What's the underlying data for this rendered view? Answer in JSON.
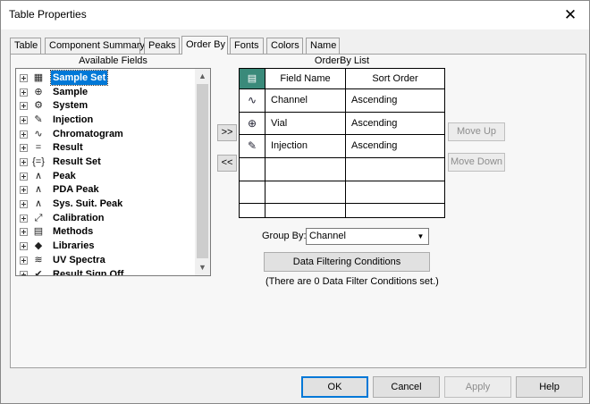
{
  "window": {
    "title": "Table Properties",
    "close_glyph": "✕"
  },
  "tabs": [
    {
      "label": "Table"
    },
    {
      "label": "Component Summary"
    },
    {
      "label": "Peaks"
    },
    {
      "label": "Order By",
      "active": true
    },
    {
      "label": "Fonts"
    },
    {
      "label": "Colors"
    },
    {
      "label": "Name"
    }
  ],
  "available_fields": {
    "label": "Available Fields",
    "items": [
      {
        "label": "Sample Set",
        "icon": "sample-set-icon",
        "glyph": "▦",
        "selected": true
      },
      {
        "label": "Sample",
        "icon": "vial-icon",
        "glyph": "⊕"
      },
      {
        "label": "System",
        "icon": "system-icon",
        "glyph": "⚙"
      },
      {
        "label": "Injection",
        "icon": "syringe-icon",
        "glyph": "✎"
      },
      {
        "label": "Chromatogram",
        "icon": "chromatogram-icon",
        "glyph": "∿"
      },
      {
        "label": "Result",
        "icon": "result-icon",
        "glyph": "="
      },
      {
        "label": "Result Set",
        "icon": "result-set-icon",
        "glyph": "{=}"
      },
      {
        "label": "Peak",
        "icon": "peak-icon",
        "glyph": "∧"
      },
      {
        "label": "PDA Peak",
        "icon": "pda-peak-icon",
        "glyph": "∧"
      },
      {
        "label": "Sys. Suit. Peak",
        "icon": "sys-suit-peak-icon",
        "glyph": "∧"
      },
      {
        "label": "Calibration",
        "icon": "calibration-icon",
        "glyph": "⤢"
      },
      {
        "label": "Methods",
        "icon": "methods-icon",
        "glyph": "▤"
      },
      {
        "label": "Libraries",
        "icon": "libraries-icon",
        "glyph": "◆"
      },
      {
        "label": "UV Spectra",
        "icon": "uv-spectra-icon",
        "glyph": "≋"
      },
      {
        "label": "Result Sign Off",
        "icon": "sign-off-icon",
        "glyph": "✔"
      }
    ]
  },
  "transfer": {
    "add_label": ">>",
    "remove_label": "<<"
  },
  "orderby": {
    "label": "OrderBy List",
    "header_icon": "list-header-icon",
    "columns": [
      "Field Name",
      "Sort Order"
    ],
    "rows": [
      {
        "icon": "chromatogram-icon",
        "glyph": "∿",
        "field": "Channel",
        "order": "Ascending"
      },
      {
        "icon": "vial-icon",
        "glyph": "⊕",
        "field": "Vial",
        "order": "Ascending"
      },
      {
        "icon": "syringe-icon",
        "glyph": "✎",
        "field": "Injection",
        "order": "Ascending"
      }
    ]
  },
  "move_up_label": "Move Up",
  "move_down_label": "Move Down",
  "group_by": {
    "label": "Group By:",
    "value": "Channel"
  },
  "filter_button_label": "Data Filtering Conditions",
  "filter_status": "(There are 0 Data Filter Conditions set.)",
  "footer": {
    "ok": "OK",
    "cancel": "Cancel",
    "apply": "Apply",
    "help": "Help"
  }
}
